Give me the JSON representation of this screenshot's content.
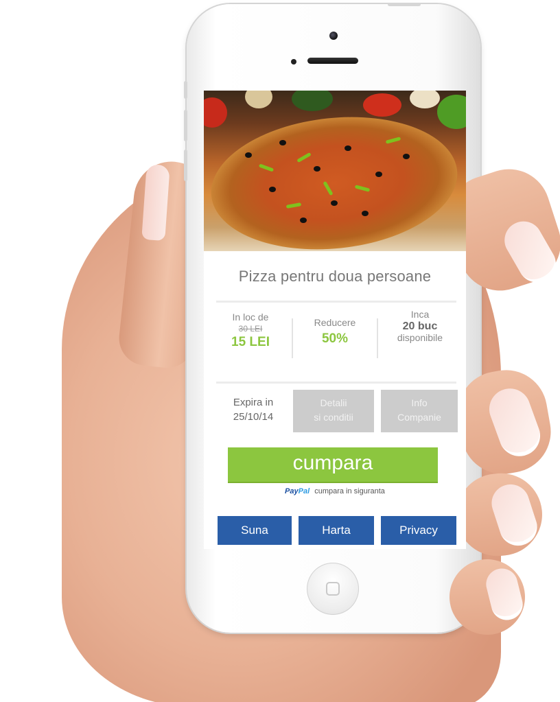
{
  "product": {
    "title": "Pizza pentru doua persoane",
    "image_alt": "pizza"
  },
  "stats": {
    "price": {
      "label": "In loc de",
      "old_price": "30 LEI",
      "new_price": "15 LEI"
    },
    "discount": {
      "label": "Reducere",
      "value": "50%"
    },
    "stock": {
      "label_top": "Inca",
      "count": "20 buc",
      "label_bottom": "disponibile"
    }
  },
  "details": {
    "expires_label": "Expira in",
    "expires_date": "25/10/14",
    "terms_line1": "Detalii",
    "terms_line2": "si conditii",
    "company_line1": "Info",
    "company_line2": "Companie"
  },
  "purchase": {
    "buy_label": "cumpara",
    "paypal_logo_a": "Pay",
    "paypal_logo_b": "Pal",
    "paypal_text": "cumpara in siguranta"
  },
  "actions": {
    "call": "Suna",
    "map": "Harta",
    "privacy": "Privacy"
  },
  "colors": {
    "accent_green": "#8cc63f",
    "action_blue": "#2a5ea8",
    "disabled_grey": "#cccccc"
  }
}
